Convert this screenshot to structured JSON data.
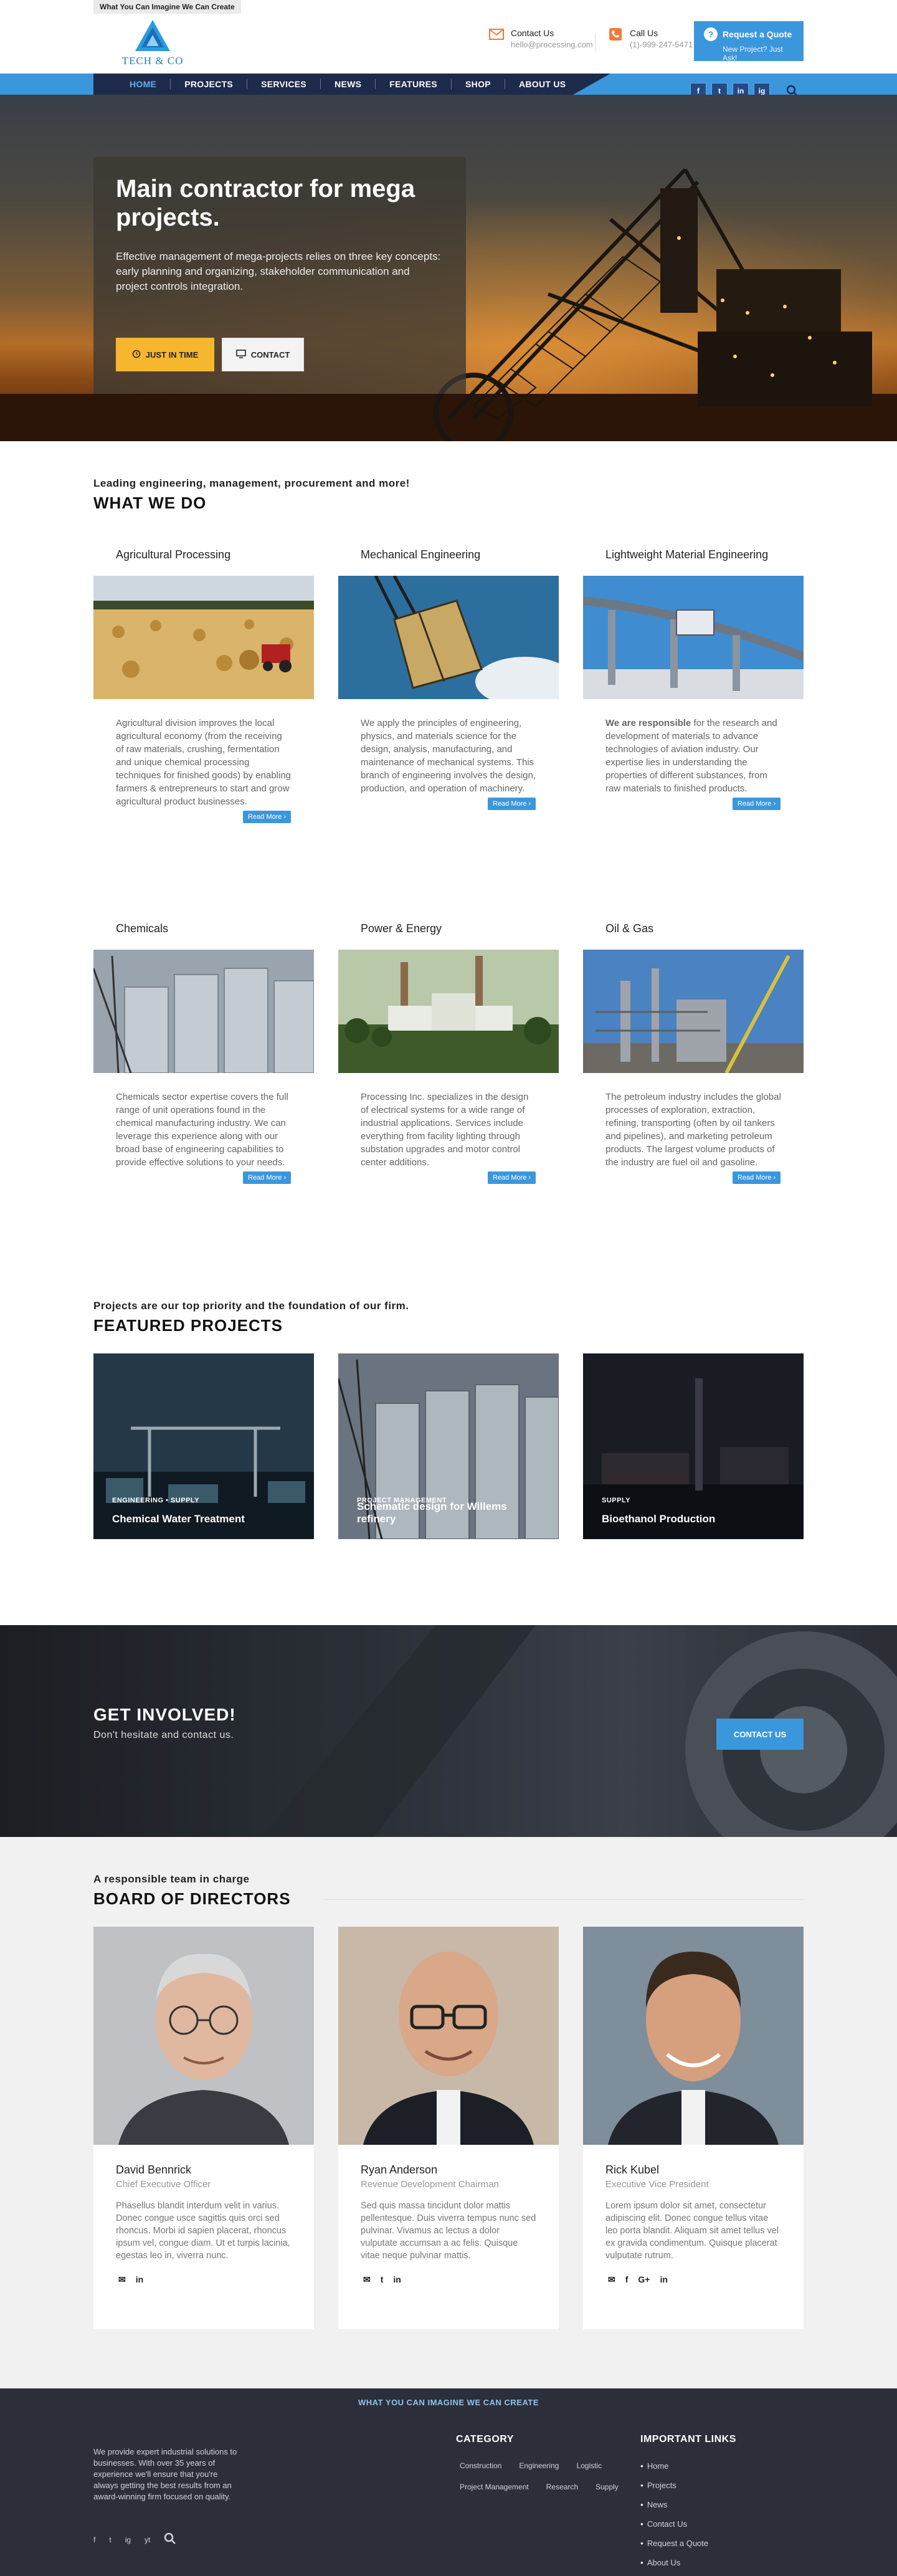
{
  "tagline": "What You Can Imagine We Can Create",
  "logo": {
    "name": "TECH & CO"
  },
  "header": {
    "contact": {
      "label": "Contact Us",
      "value": "hello@processing.com"
    },
    "call": {
      "label": "Call Us",
      "value": "(1)-999-247-5471"
    },
    "quote": {
      "label": "Request a Quote",
      "sub": "New Project? Just Ask!"
    }
  },
  "nav": {
    "items": [
      "HOME",
      "PROJECTS",
      "SERVICES",
      "NEWS",
      "FEATURES",
      "SHOP",
      "ABOUT US"
    ],
    "active": "HOME"
  },
  "social": [
    "f",
    "t",
    "in",
    "ig"
  ],
  "hero": {
    "title": "Main contractor for mega projects.",
    "text": "Effective management of mega-projects relies on three key concepts: early planning and organizing, stakeholder communication and project controls integration.",
    "btn1": "JUST IN TIME",
    "btn2": "CONTACT"
  },
  "what": {
    "subtitle": "Leading engineering, management, procurement and more!",
    "title": "WHAT WE DO",
    "read_more": "Read More ›",
    "cards": [
      {
        "title": "Agricultural Processing",
        "text": "Agricultural division improves the local agricultural economy (from the receiving of raw materials, crushing, fermentation and unique chemical processing techniques for finished goods) by enabling farmers & entrepreneurs to start and grow agricultural product businesses."
      },
      {
        "title": "Mechanical Engineering",
        "text": "We apply the principles of engineering, physics, and materials science for the design, analysis, manufacturing, and maintenance of mechanical systems. This branch of engineering involves the design, production, and operation of machinery."
      },
      {
        "title": "Lightweight Material Engineering",
        "bold": "We are responsible",
        "text": " for the research and development of materials to advance technologies of aviation industry. Our expertise lies in understanding the properties of different substances, from raw materials to finished products."
      },
      {
        "title": "Chemicals",
        "text": "Chemicals sector expertise covers the full range of unit operations found in the chemical manufacturing industry. We can leverage this experience along with our broad base of engineering capabilities to provide effective solutions to your needs."
      },
      {
        "title": "Power & Energy",
        "text": "Processing Inc. specializes in the design of electrical systems for a wide range of industrial applications. Services include everything from facility lighting through substation upgrades and motor control center additions."
      },
      {
        "title": "Oil & Gas",
        "text": "The petroleum industry includes the global processes of exploration, extraction, refining, transporting (often by oil tankers and pipelines), and marketing petroleum products. The largest volume products of the industry are fuel oil and gasoline."
      }
    ]
  },
  "featured": {
    "subtitle": "Projects are our top priority and the foundation of our firm.",
    "title": "FEATURED PROJECTS",
    "items": [
      {
        "category": "ENGINEERING • SUPPLY",
        "title": "Chemical Water Treatment"
      },
      {
        "category": "PROJECT MANAGEMENT",
        "title": "Schematic design for Willems refinery"
      },
      {
        "category": "SUPPLY",
        "title": "Bioethanol Production"
      }
    ]
  },
  "involved": {
    "title": "GET INVOLVED!",
    "text": "Don't hesitate and contact us.",
    "button": "CONTACT US"
  },
  "board": {
    "subtitle": "A responsible team in charge",
    "title": "BOARD OF DIRECTORS",
    "members": [
      {
        "name": "David Bennrick",
        "role": "Chief Executive Officer",
        "bio": "Phasellus blandit interdum velit in varius. Donec congue usce sagittis quis orci sed rhoncus. Morbi id sapien placerat, rhoncus ipsum vel, congue diam. Ut et turpis lacinia, egestas leo in, viverra nunc.",
        "social": [
          "✉",
          "in"
        ]
      },
      {
        "name": "Ryan Anderson",
        "role": "Revenue Development Chairman",
        "bio": "Sed quis massa tincidunt dolor mattis pellentesque. Duis viverra tempus nunc sed pulvinar. Vivamus ac lectus a dolor vulputate accumsan a ac felis. Quisque vitae neque pulvinar mattis.",
        "social": [
          "✉",
          "t",
          "in"
        ]
      },
      {
        "name": "Rick Kubel",
        "role": "Executive Vice President",
        "bio": "Lorem ipsum dolor sit amet, consectetur adipiscing elit. Donec congue tellus vitae leo porta blandit. Aliquam sit amet tellus vel ex gravida condimentum. Quisque placerat vulputate rutrum.",
        "social": [
          "✉",
          "f",
          "G+",
          "in"
        ]
      }
    ]
  },
  "footer": {
    "tagline": "WHAT YOU CAN IMAGINE WE CAN CREATE",
    "about": "We provide expert industrial solutions to businesses. With over 35 years of experience we'll ensure that you're always getting the best results from an award-winning firm focused on quality.",
    "category_title": "CATEGORY",
    "categories": [
      "Construction",
      "Engineering",
      "Logistic",
      "Project Management",
      "Research",
      "Supply"
    ],
    "links_title": "IMPORTANT LINKS",
    "links": [
      "Home",
      "Projects",
      "News",
      "Contact Us",
      "Request a Quote",
      "About Us"
    ],
    "social": [
      "f",
      "t",
      "ig",
      "yt"
    ]
  }
}
